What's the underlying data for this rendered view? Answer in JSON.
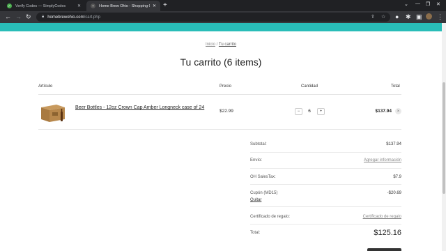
{
  "browser": {
    "tabs": [
      {
        "title": "Verify Codes — SimplyCodes",
        "favicon": "check-circle-icon",
        "active": false
      },
      {
        "title": "Home Brew Ohio - Shopping Cart",
        "favicon": "store-icon",
        "active": true
      }
    ],
    "url_host": "homebrewohio.com",
    "url_path": "/cart.php"
  },
  "breadcrumb": {
    "home": "Inicio",
    "separator": "/",
    "current": "Tu carrito"
  },
  "page_title": "Tu carrito (6 items)",
  "table_headers": {
    "item": "Artículo",
    "price": "Precio",
    "quantity": "Cantidad",
    "total": "Total"
  },
  "cart_item": {
    "name": "Beer Bottles - 12oz Crown Cap Amber Longneck case of 24",
    "price": "$22.99",
    "quantity": "6",
    "total": "$137.94",
    "decrement": "−",
    "increment": "+",
    "remove": "×"
  },
  "summary": {
    "subtotal_label": "Subtotal:",
    "subtotal_value": "$137.94",
    "shipping_label": "Envío:",
    "shipping_value": "Agregar información",
    "tax_label": "OH SalesTax:",
    "tax_value": "$7.9",
    "coupon_label": "Cupón (MD15)",
    "coupon_value": "-$20.69",
    "coupon_remove": "Quitar",
    "gift_label": "Certificado de regalo:",
    "gift_value": "Certificado de regalo",
    "total_label": "Total:",
    "total_value": "$125.16"
  },
  "colors": {
    "accent_bar": "#29bdb8",
    "chrome_dark": "#202124",
    "chrome_mid": "#35363a"
  }
}
